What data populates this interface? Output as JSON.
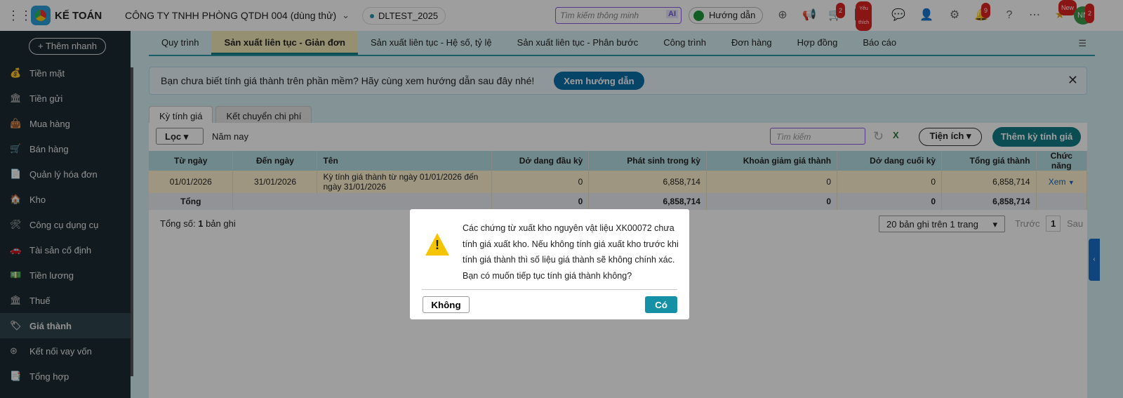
{
  "header": {
    "brand": "KẾ TOÁN",
    "company": "CÔNG TY TNHH PHÒNG QTDH 004 (dùng thử)",
    "database": "DLTEST_2025",
    "search_placeholder": "Tìm kiếm thông minh",
    "ai_label": "AI",
    "guide_label": "Hướng dẫn",
    "cart_badge": "2",
    "favorite_badge": "Yêu thích",
    "notification_badge": "9",
    "new_badge": "New",
    "avatar": "NN",
    "avatar_badge": "2"
  },
  "sidebar": {
    "quick_add": "+ Thêm nhanh",
    "items": [
      {
        "label": "Tiền mặt"
      },
      {
        "label": "Tiền gửi"
      },
      {
        "label": "Mua hàng"
      },
      {
        "label": "Bán hàng"
      },
      {
        "label": "Quản lý hóa đơn"
      },
      {
        "label": "Kho"
      },
      {
        "label": "Công cụ dụng cụ"
      },
      {
        "label": "Tài sản cố định"
      },
      {
        "label": "Tiền lương"
      },
      {
        "label": "Thuế"
      },
      {
        "label": "Giá thành"
      },
      {
        "label": "Kết nối vay vốn"
      },
      {
        "label": "Tổng hợp"
      }
    ]
  },
  "tabs": [
    "Quy trình",
    "Sản xuất liên tục - Giản đơn",
    "Sản xuất liên tục - Hệ số, tỷ lệ",
    "Sản xuất liên tục - Phân bước",
    "Công trình",
    "Đơn hàng",
    "Hợp đồng",
    "Báo cáo"
  ],
  "banner": {
    "text": "Bạn chưa biết tính giá thành trên phần mềm? Hãy cùng xem hướng dẫn sau đây nhé!",
    "button": "Xem hướng dẫn"
  },
  "subtabs": [
    "Kỳ tính giá",
    "Kết chuyển chi phí"
  ],
  "toolbar": {
    "filter": "Lọc",
    "period": "Năm nay",
    "search_placeholder": "Tìm kiếm",
    "utilities": "Tiện ích",
    "add": "Thêm kỳ tính giá"
  },
  "table": {
    "headers": [
      "Từ ngày",
      "Đến ngày",
      "Tên",
      "Dở dang đầu kỳ",
      "Phát sinh trong kỳ",
      "Khoản giảm giá thành",
      "Dở dang cuối kỳ",
      "Tổng giá thành",
      "Chức năng"
    ],
    "rows": [
      [
        "01/01/2026",
        "31/01/2026",
        "Kỳ tính giá thành từ ngày 01/01/2026 đến ngày 31/01/2026",
        "0",
        "6,858,714",
        "0",
        "0",
        "6,858,714",
        "Xem"
      ]
    ],
    "total": [
      "Tổng",
      "0",
      "6,858,714",
      "0",
      "0",
      "6,858,714"
    ]
  },
  "footer": {
    "count_label": "Tổng số:",
    "count": "1",
    "count_unit": "bản ghi",
    "page_size": "20 bản ghi trên 1 trang",
    "prev": "Trước",
    "page": "1",
    "next": "Sau"
  },
  "dialog": {
    "message": "Các chứng từ xuất kho nguyên vật liệu XK00072 chưa tính giá xuất kho. Nếu không tính giá xuất kho trước khi tính giá thành thì số liệu giá thành sẽ không chính xác. Bạn có muốn tiếp tục tính giá thành không?",
    "no": "Không",
    "yes": "Có"
  }
}
